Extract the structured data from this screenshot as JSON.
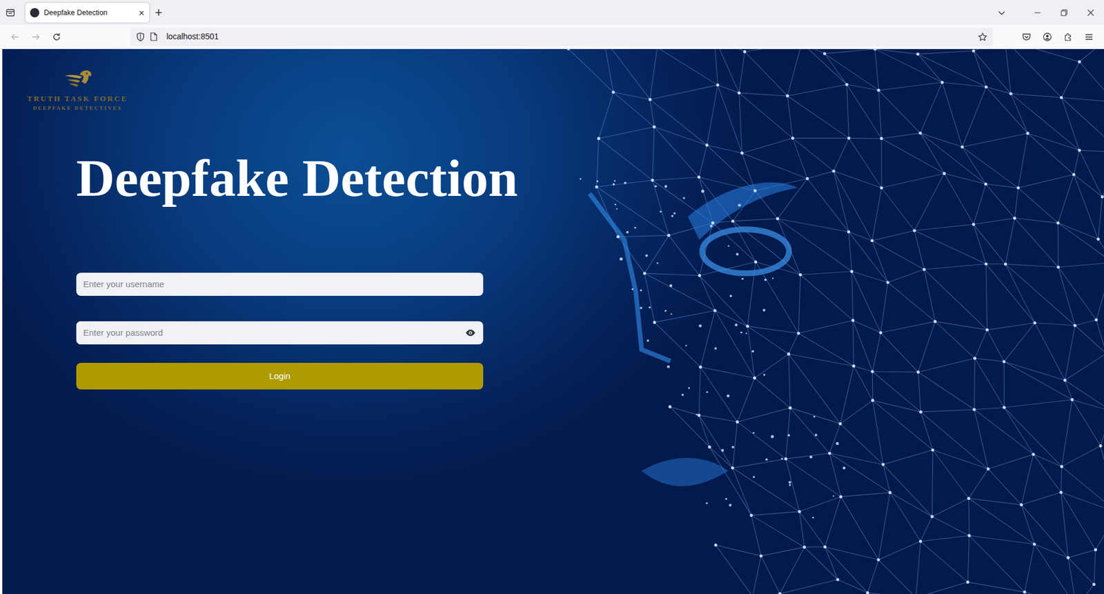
{
  "browser": {
    "tabs": [
      {
        "label": "Deepfake Detection",
        "selected": true,
        "close": "×"
      }
    ],
    "new_tab": "+",
    "nav": {
      "back_disabled": true,
      "forward_disabled": true
    },
    "address": "localhost:8501"
  },
  "page": {
    "logo": {
      "title": "TRUTH TASK FORCE",
      "subtitle": "DEEPFAKE DETECTIVES"
    },
    "heading": "Deepfake Detection",
    "username": {
      "placeholder": "Enter your username"
    },
    "password": {
      "placeholder": "Enter your password"
    },
    "login_button": "Login"
  }
}
